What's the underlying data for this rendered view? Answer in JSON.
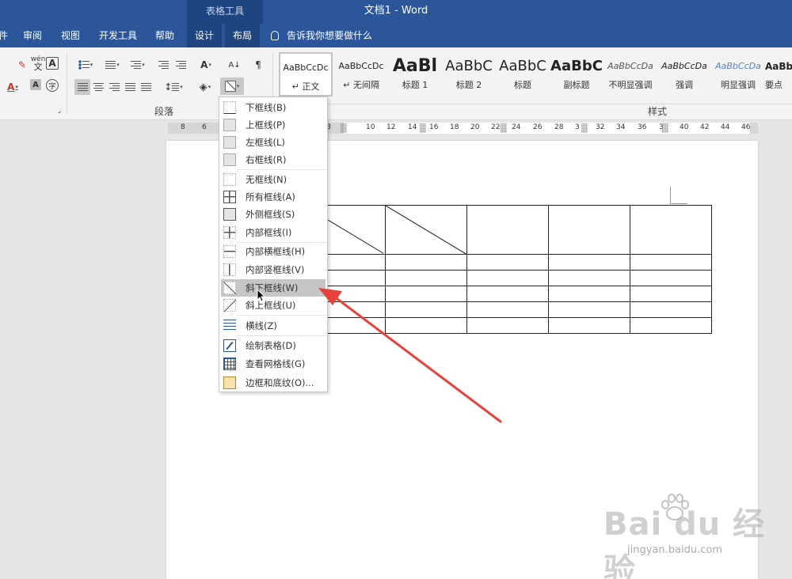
{
  "titlebar": {
    "context_group": "表格工具",
    "doc_title": "文档1  -  Word"
  },
  "tabs": [
    {
      "label": "件"
    },
    {
      "label": "审阅"
    },
    {
      "label": "视图"
    },
    {
      "label": "开发工具"
    },
    {
      "label": "帮助"
    },
    {
      "label": "设计"
    },
    {
      "label": "布局"
    }
  ],
  "tell_me": "告诉我你想要做什么",
  "ribbon": {
    "paragraph_group": "段落",
    "styles_group": "样式",
    "pinyin_label": "wén",
    "pinyin_char": "文"
  },
  "styles": [
    {
      "sample": "AaBbCcDc",
      "name": "正文",
      "marker": "↵"
    },
    {
      "sample": "AaBbCcDc",
      "name": "无间隔",
      "marker": "↵"
    },
    {
      "sample": "AaBl",
      "name": "标题 1"
    },
    {
      "sample": "AaBbC",
      "name": "标题 2"
    },
    {
      "sample": "AaBbC",
      "name": "标题"
    },
    {
      "sample": "AaBbC",
      "name": "副标题"
    },
    {
      "sample": "AaBbCcDa",
      "name": "不明显强调"
    },
    {
      "sample": "AaBbCcDa",
      "name": "强调"
    },
    {
      "sample": "AaBbCcDa",
      "name": "明显强调"
    },
    {
      "sample": "AaBb",
      "name": "要点"
    }
  ],
  "ruler": {
    "numbers": [
      "8",
      "6",
      "8",
      "10",
      "12",
      "14",
      "16",
      "18",
      "20",
      "22",
      "24",
      "26",
      "28",
      "3",
      "32",
      "34",
      "36",
      "3",
      "40",
      "42",
      "44",
      "46"
    ]
  },
  "border_menu": {
    "items": [
      {
        "label": "下框线(B)",
        "icon": "bottom-border-icon"
      },
      {
        "label": "上框线(P)",
        "icon": "top-border-icon"
      },
      {
        "label": "左框线(L)",
        "icon": "left-border-icon"
      },
      {
        "label": "右框线(R)",
        "icon": "right-border-icon"
      },
      {
        "label": "无框线(N)",
        "icon": "no-border-icon"
      },
      {
        "label": "所有框线(A)",
        "icon": "all-borders-icon"
      },
      {
        "label": "外侧框线(S)",
        "icon": "outside-borders-icon"
      },
      {
        "label": "内部框线(I)",
        "icon": "inside-borders-icon"
      },
      {
        "label": "内部横框线(H)",
        "icon": "inside-horizontal-border-icon"
      },
      {
        "label": "内部竖框线(V)",
        "icon": "inside-vertical-border-icon"
      },
      {
        "label": "斜下框线(W)",
        "icon": "diagonal-down-border-icon"
      },
      {
        "label": "斜上框线(U)",
        "icon": "diagonal-up-border-icon"
      },
      {
        "label": "横线(Z)",
        "icon": "horizontal-line-icon"
      },
      {
        "label": "绘制表格(D)",
        "icon": "draw-table-icon"
      },
      {
        "label": "查看网格线(G)",
        "icon": "view-gridlines-icon"
      },
      {
        "label": "边框和底纹(O)...",
        "icon": "borders-shading-icon"
      }
    ],
    "highlighted": "斜下框线(W)"
  },
  "watermark": {
    "logo": "Bai du 经验",
    "url": "jingyan.baidu.com"
  },
  "colors": {
    "word_blue": "#2b579a",
    "context_tab": "#1e4580",
    "arrow_red": "#e8413c",
    "menu_hover": "#c6c6c6"
  }
}
